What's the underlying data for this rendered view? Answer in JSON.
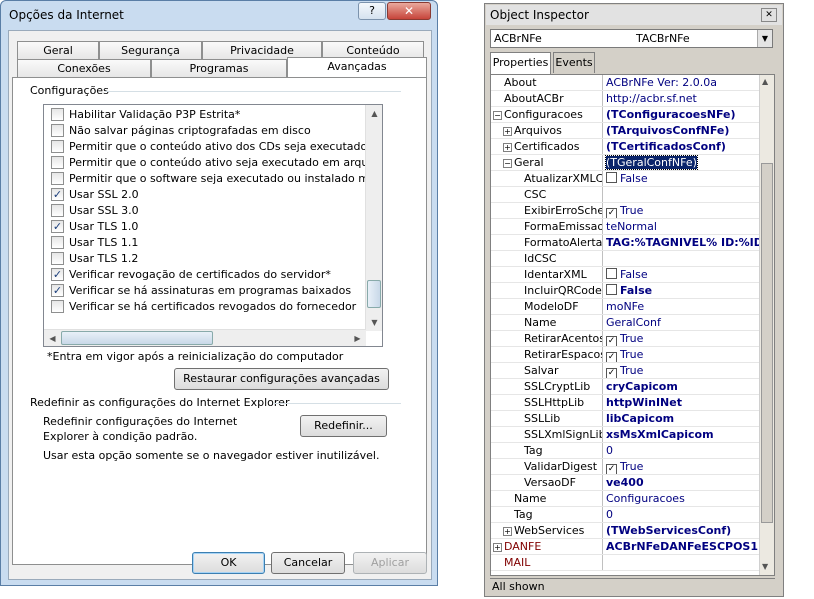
{
  "dialog": {
    "title": "Opções da Internet",
    "help": "?",
    "close": "✕",
    "tabs_row1": [
      "Geral",
      "Segurança",
      "Privacidade",
      "Conteúdo"
    ],
    "tabs_row2": [
      "Conexões",
      "Programas",
      "Avançadas"
    ],
    "active_tab": "Avançadas",
    "settings_group": "Configurações",
    "list_items": [
      {
        "label": "Habilitar Validação P3P Estrita*",
        "checked": false
      },
      {
        "label": "Não salvar páginas criptografadas em disco",
        "checked": false
      },
      {
        "label": "Permitir que o conteúdo ativo dos CDs seja executado no",
        "checked": false
      },
      {
        "label": "Permitir que o conteúdo ativo seja executado em arquivos",
        "checked": false
      },
      {
        "label": "Permitir que o software seja executado ou instalado mesm",
        "checked": false
      },
      {
        "label": "Usar SSL 2.0",
        "checked": true
      },
      {
        "label": "Usar SSL 3.0",
        "checked": false
      },
      {
        "label": "Usar TLS 1.0",
        "checked": true
      },
      {
        "label": "Usar TLS 1.1",
        "checked": false
      },
      {
        "label": "Usar TLS 1.2",
        "checked": false
      },
      {
        "label": "Verificar revogação de certificados do servidor*",
        "checked": true
      },
      {
        "label": "Verificar se há assinaturas em programas baixados",
        "checked": true
      },
      {
        "label": "Verificar se há certificados revogados do fornecedor",
        "checked": false
      }
    ],
    "restart_note": "*Entra em vigor após a reinicialização do computador",
    "restore_button": "Restaurar configurações avançadas",
    "reset_group": "Redefinir as configurações do Internet Explorer",
    "reset_text": "Redefinir configurações do Internet Explorer à condição padrão.",
    "reset_button": "Redefinir...",
    "reset_hint": "Usar esta opção somente se o navegador estiver inutilizável.",
    "ok": "OK",
    "cancel": "Cancelar",
    "apply": "Aplicar"
  },
  "inspector": {
    "title": "Object Inspector",
    "close": "✕",
    "component": "ACBrNFe",
    "component_type": "TACBrNFe",
    "tabs": [
      "Properties",
      "Events"
    ],
    "status": "All shown",
    "rows": [
      {
        "name": "About",
        "value": "ACBrNFe Ver: 2.0.0a",
        "indent": 0,
        "expander": "",
        "bold": false,
        "check": ""
      },
      {
        "name": "AboutACBr",
        "value": "http://acbr.sf.net",
        "indent": 0,
        "expander": "",
        "bold": false,
        "check": ""
      },
      {
        "name": "Configuracoes",
        "value": "(TConfiguracoesNFe)",
        "indent": 0,
        "expander": "⊟",
        "bold": true,
        "check": ""
      },
      {
        "name": "Arquivos",
        "value": "(TArquivosConfNFe)",
        "indent": 1,
        "expander": "⊞",
        "bold": true,
        "check": ""
      },
      {
        "name": "Certificados",
        "value": "(TCertificadosConf)",
        "indent": 1,
        "expander": "⊞",
        "bold": true,
        "check": ""
      },
      {
        "name": "Geral",
        "value": "(TGeralConfNFe)",
        "indent": 1,
        "expander": "⊟",
        "bold": false,
        "check": ""
      },
      {
        "name": "AtualizarXMLCar",
        "value": "False",
        "indent": 2,
        "expander": "",
        "bold": false,
        "check": "unchecked"
      },
      {
        "name": "CSC",
        "value": "",
        "indent": 2,
        "expander": "",
        "bold": false,
        "check": ""
      },
      {
        "name": "ExibirErroSchem",
        "value": "True",
        "indent": 2,
        "expander": "",
        "bold": false,
        "check": "checked"
      },
      {
        "name": "FormaEmissao",
        "value": "teNormal",
        "indent": 2,
        "expander": "",
        "bold": false,
        "check": ""
      },
      {
        "name": "FormatoAlerta",
        "value": "TAG:%TAGNIVEL% ID:%ID",
        "indent": 2,
        "expander": "",
        "bold": true,
        "check": ""
      },
      {
        "name": "IdCSC",
        "value": "",
        "indent": 2,
        "expander": "",
        "bold": false,
        "check": ""
      },
      {
        "name": "IdentarXML",
        "value": "False",
        "indent": 2,
        "expander": "",
        "bold": false,
        "check": "unchecked"
      },
      {
        "name": "IncluirQRCodeX",
        "value": "False",
        "indent": 2,
        "expander": "",
        "bold": true,
        "check": "unchecked"
      },
      {
        "name": "ModeloDF",
        "value": "moNFe",
        "indent": 2,
        "expander": "",
        "bold": false,
        "check": ""
      },
      {
        "name": "Name",
        "value": "GeralConf",
        "indent": 2,
        "expander": "",
        "bold": false,
        "check": ""
      },
      {
        "name": "RetirarAcentos",
        "value": "True",
        "indent": 2,
        "expander": "",
        "bold": false,
        "check": "checked"
      },
      {
        "name": "RetirarEspacos",
        "value": "True",
        "indent": 2,
        "expander": "",
        "bold": false,
        "check": "checked"
      },
      {
        "name": "Salvar",
        "value": "True",
        "indent": 2,
        "expander": "",
        "bold": false,
        "check": "checked"
      },
      {
        "name": "SSLCryptLib",
        "value": "cryCapicom",
        "indent": 2,
        "expander": "",
        "bold": true,
        "check": ""
      },
      {
        "name": "SSLHttpLib",
        "value": "httpWinINet",
        "indent": 2,
        "expander": "",
        "bold": true,
        "check": ""
      },
      {
        "name": "SSLLib",
        "value": "libCapicom",
        "indent": 2,
        "expander": "",
        "bold": true,
        "check": ""
      },
      {
        "name": "SSLXmlSignLib",
        "value": "xsMsXmlCapicom",
        "indent": 2,
        "expander": "",
        "bold": true,
        "check": ""
      },
      {
        "name": "Tag",
        "value": "0",
        "indent": 2,
        "expander": "",
        "bold": false,
        "check": ""
      },
      {
        "name": "ValidarDigest",
        "value": "True",
        "indent": 2,
        "expander": "",
        "bold": false,
        "check": "checked"
      },
      {
        "name": "VersaoDF",
        "value": "ve400",
        "indent": 2,
        "expander": "",
        "bold": true,
        "check": ""
      },
      {
        "name": "Name",
        "value": "Configuracoes",
        "indent": 1,
        "expander": "",
        "bold": false,
        "check": ""
      },
      {
        "name": "Tag",
        "value": "0",
        "indent": 1,
        "expander": "",
        "bold": false,
        "check": ""
      },
      {
        "name": "WebServices",
        "value": "(TWebServicesConf)",
        "indent": 1,
        "expander": "⊞",
        "bold": true,
        "check": ""
      },
      {
        "name": "DANFE",
        "value": "ACBrNFeDANFeESCPOS1",
        "indent": 0,
        "expander": "⊞",
        "bold": true,
        "check": "",
        "name_color": "#800000"
      },
      {
        "name": "MAIL",
        "value": "",
        "indent": 0,
        "expander": "",
        "bold": false,
        "check": "",
        "name_color": "#800000"
      }
    ]
  }
}
